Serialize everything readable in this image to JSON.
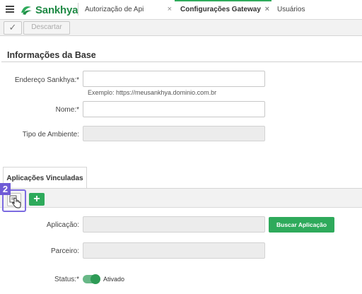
{
  "header": {
    "brand": "Sankhya",
    "tabs": [
      {
        "label": "Autorização de Api",
        "close": "×"
      },
      {
        "label": "Configurações Gateway",
        "close": "×"
      },
      {
        "label": "Usuários",
        "close": ""
      }
    ]
  },
  "toolbar": {
    "confirm_icon": "✓",
    "discard_label": "Descartar"
  },
  "base": {
    "title": "Informações da Base",
    "endereco_label": "Endereço Sankhya:",
    "endereco_value": "",
    "endereco_hint": "Exemplo: https://meusankhya.dominio.com.br",
    "nome_label": "Nome:",
    "nome_value": "",
    "tipo_label": "Tipo de Ambiente:",
    "tipo_value": "",
    "required_mark": "*"
  },
  "apps": {
    "tab_label": "Aplicações Vinculadas",
    "step_number": "2",
    "add_icon": "+",
    "aplicacao_label": "Aplicação:",
    "aplicacao_value": "",
    "buscar_label": "Buscar Aplicação",
    "parceiro_label": "Parceiro:",
    "parceiro_value": "",
    "status_label": "Status:",
    "status_value": "Ativado",
    "status_on": true
  },
  "colors": {
    "brand_green": "#2eaa5b",
    "highlight_purple": "#7c6be0"
  },
  "icons": [
    "hamburger-icon",
    "sankhya-logo-icon",
    "check-icon",
    "edit-icon",
    "hand-cursor-icon",
    "plus-icon",
    "close-icon"
  ]
}
